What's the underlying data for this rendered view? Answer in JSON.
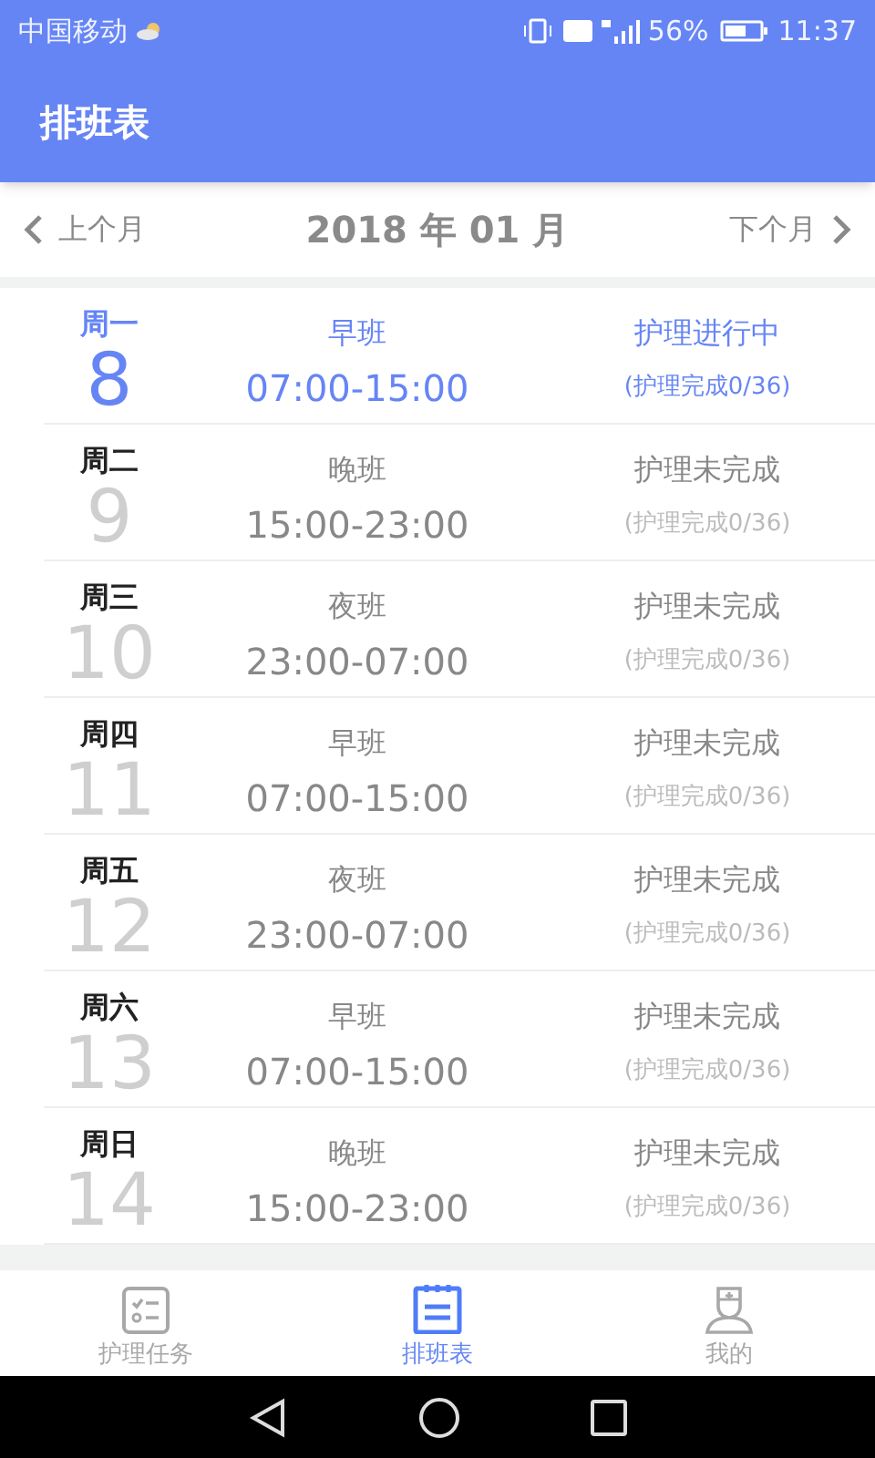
{
  "status_bar": {
    "carrier": "中国移动",
    "battery_text": "56%",
    "time": "11:37"
  },
  "app_bar": {
    "title": "排班表"
  },
  "month_nav": {
    "prev": "上个月",
    "current": "2018 年 01 月",
    "next": "下个月"
  },
  "days": [
    {
      "weekday": "周一",
      "day": "8",
      "shift": "早班",
      "hours": "07:00-15:00",
      "status": "护理进行中",
      "progress": "(护理完成0/36)",
      "selected": true
    },
    {
      "weekday": "周二",
      "day": "9",
      "shift": "晚班",
      "hours": "15:00-23:00",
      "status": "护理未完成",
      "progress": "(护理完成0/36)",
      "selected": false
    },
    {
      "weekday": "周三",
      "day": "10",
      "shift": "夜班",
      "hours": "23:00-07:00",
      "status": "护理未完成",
      "progress": "(护理完成0/36)",
      "selected": false
    },
    {
      "weekday": "周四",
      "day": "11",
      "shift": "早班",
      "hours": "07:00-15:00",
      "status": "护理未完成",
      "progress": "(护理完成0/36)",
      "selected": false
    },
    {
      "weekday": "周五",
      "day": "12",
      "shift": "夜班",
      "hours": "23:00-07:00",
      "status": "护理未完成",
      "progress": "(护理完成0/36)",
      "selected": false
    },
    {
      "weekday": "周六",
      "day": "13",
      "shift": "早班",
      "hours": "07:00-15:00",
      "status": "护理未完成",
      "progress": "(护理完成0/36)",
      "selected": false
    },
    {
      "weekday": "周日",
      "day": "14",
      "shift": "晚班",
      "hours": "15:00-23:00",
      "status": "护理未完成",
      "progress": "(护理完成0/36)",
      "selected": false
    }
  ],
  "bottom_nav": [
    {
      "kind": "tasks",
      "label": "护理任务",
      "selected": false
    },
    {
      "kind": "schedule",
      "label": "排班表",
      "selected": true
    },
    {
      "kind": "profile",
      "label": "我的",
      "selected": false
    }
  ]
}
